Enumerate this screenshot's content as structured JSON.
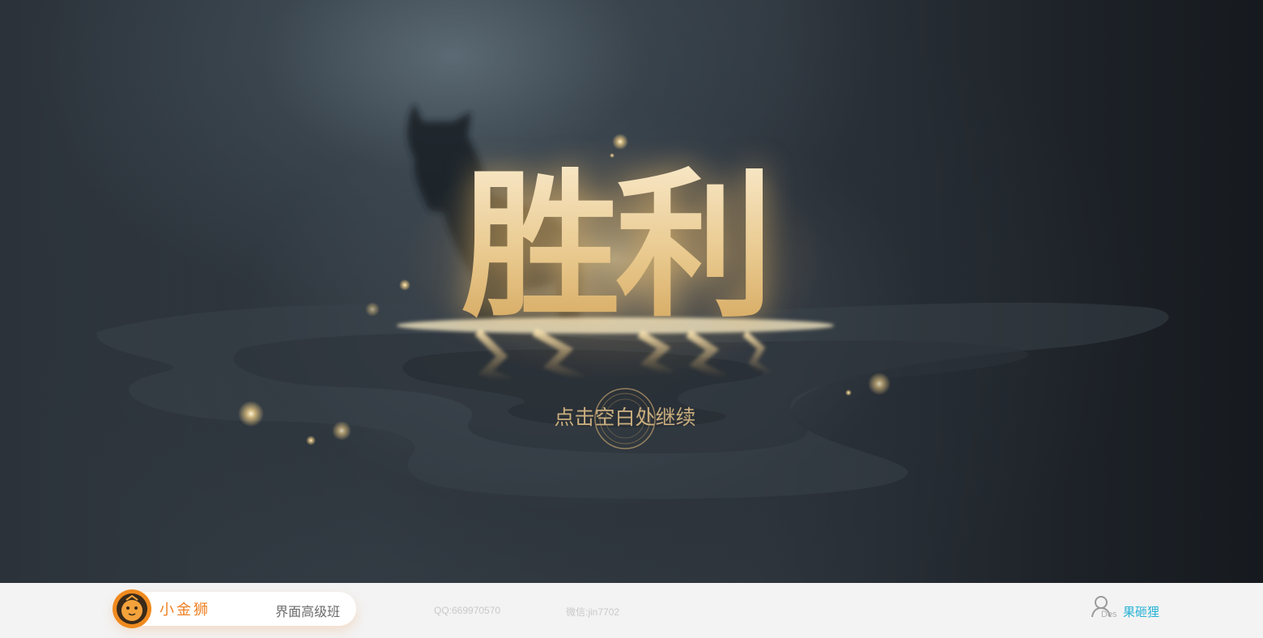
{
  "scene": {
    "title": "胜利",
    "prompt": "点击空白处继续",
    "accent_color": "#e9c98e",
    "sparkle_color": "#ffe6a8",
    "icons": [
      "cat-silhouette",
      "water-reflection",
      "sparkle",
      "ring-icon"
    ]
  },
  "footer": {
    "brand_name": "小金狮",
    "course_name": "界面高级班",
    "qq": "QQ:669970570",
    "wechat": "微信:jin7702",
    "user_tag": "Des",
    "user_name": "果砸狸",
    "brand_color": "#ef7f22",
    "user_name_color": "#2bb3d6",
    "icons": [
      "lion-logo-icon",
      "user-icon"
    ]
  }
}
